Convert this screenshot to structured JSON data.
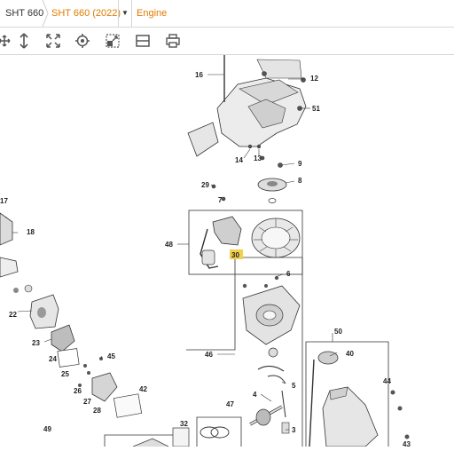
{
  "breadcrumb": {
    "home": "SHT 660",
    "model": "SHT 660 (2022)",
    "category": "Engine"
  },
  "toolbar": {
    "icons": [
      "pan-icon",
      "vertical-move-icon",
      "fit-screen-icon",
      "target-icon",
      "zoom-region-icon",
      "split-view-icon",
      "print-icon"
    ]
  },
  "diagram": {
    "highlight_color": "#f2d04a",
    "callouts": {
      "c16": "16",
      "c12": "12",
      "c51": "51",
      "c14": "14",
      "c13": "13",
      "c9": "9",
      "c8": "8",
      "c29": "29",
      "c7": "7",
      "c48": "48",
      "c30": "30",
      "c6": "6",
      "c46": "46",
      "c17": "17",
      "c18": "18",
      "c22": "22",
      "c23": "23",
      "c24": "24",
      "c45": "45",
      "c25": "25",
      "c26": "26",
      "c42": "42",
      "c27": "27",
      "c28": "28",
      "c50": "50",
      "c40": "40",
      "c44": "44",
      "c43": "43",
      "c5": "5",
      "c4": "4",
      "c3": "3",
      "c47": "47",
      "c32": "32",
      "c49": "49"
    }
  }
}
